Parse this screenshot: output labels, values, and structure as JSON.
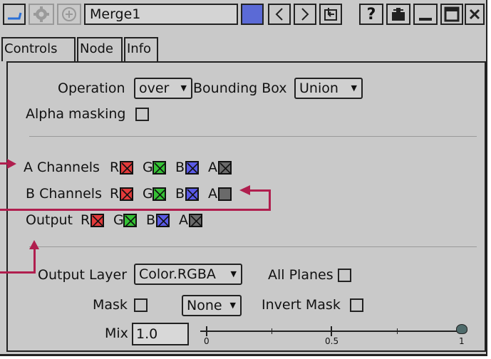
{
  "title_bar": {
    "node_name": "Merge1",
    "help_label": "?"
  },
  "tabs": [
    {
      "label": "Controls"
    },
    {
      "label": "Node"
    },
    {
      "label": "Info"
    }
  ],
  "controls": {
    "operation_label": "Operation",
    "operation_value": "over",
    "bounding_box_label": "Bounding Box",
    "bounding_box_value": "Union",
    "alpha_masking_label": "Alpha masking",
    "a_channels_label": "A Channels",
    "b_channels_label": "B Channels",
    "output_label": "Output",
    "channel_letters": [
      "R",
      "G",
      "B",
      "A"
    ],
    "output_layer_label": "Output Layer",
    "output_layer_value": "Color.RGBA",
    "all_planes_label": "All Planes",
    "mask_label": "Mask",
    "mask_value": "None",
    "invert_mask_label": "Invert Mask",
    "mix_label": "Mix",
    "mix_value": "1.0",
    "mix_ticks": [
      "0",
      "0.5",
      "1"
    ]
  },
  "colors": {
    "red": "#e23a3a",
    "green": "#35c235",
    "blue": "#5a5ae6",
    "alpha": "#6a6a6a",
    "annotation_arrow": "#b01e4e",
    "node_color": "#5b6ad6"
  }
}
